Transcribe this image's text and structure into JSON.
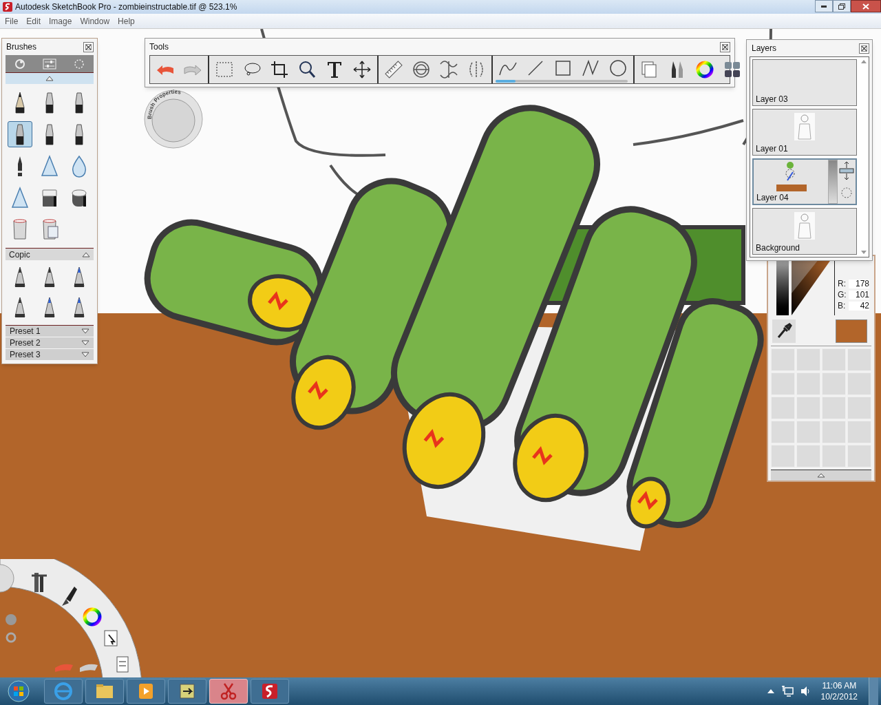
{
  "window": {
    "title": "Autodesk SketchBook Pro - zombieinstructable.tif @ 523.1%"
  },
  "menu": [
    "File",
    "Edit",
    "Image",
    "Window",
    "Help"
  ],
  "brushes": {
    "title": "Brushes",
    "items": [
      {
        "selected": false
      },
      {
        "selected": false
      },
      {
        "selected": false
      },
      {
        "selected": true
      },
      {
        "selected": false
      },
      {
        "selected": false
      },
      {
        "selected": false
      },
      {
        "selected": false
      },
      {
        "selected": false
      },
      {
        "selected": false
      },
      {
        "selected": false
      },
      {
        "selected": false
      },
      {
        "selected": false
      },
      {
        "selected": false
      }
    ],
    "copic": {
      "title": "Copic",
      "expanded": true,
      "items": [
        {
          "selected": false
        },
        {
          "selected": false
        },
        {
          "selected": false
        },
        {
          "selected": false
        },
        {
          "selected": false
        },
        {
          "selected": false
        }
      ]
    },
    "presets": [
      {
        "label": "Preset 1",
        "expanded": false
      },
      {
        "label": "Preset 2",
        "expanded": false
      },
      {
        "label": "Preset 3",
        "expanded": false
      }
    ]
  },
  "tools": {
    "title": "Tools",
    "stroke_slider": {
      "level": 0.15
    }
  },
  "brush_properties": {
    "label": "Brush Properties"
  },
  "layers": {
    "title": "Layers",
    "items": [
      {
        "name": "Layer 03",
        "kind": "empty",
        "selected": false
      },
      {
        "name": "Layer 01",
        "kind": "sketch",
        "selected": false
      },
      {
        "name": "Layer 04",
        "kind": "color",
        "selected": true
      },
      {
        "name": "Background",
        "kind": "sketch",
        "selected": false
      }
    ]
  },
  "color": {
    "channels": [
      {
        "label": "R:",
        "value": "178"
      },
      {
        "label": "G:",
        "value": "101"
      },
      {
        "label": "B:",
        "value": "42"
      }
    ],
    "swatch": {
      "color": "#b2652a"
    }
  },
  "taskbar": {
    "apps": [
      {
        "selected": false
      },
      {
        "selected": false
      },
      {
        "selected": false
      },
      {
        "selected": false
      },
      {
        "selected": true
      },
      {
        "selected": false
      }
    ],
    "time": "11:06 AM",
    "date": "10/2/2012"
  }
}
